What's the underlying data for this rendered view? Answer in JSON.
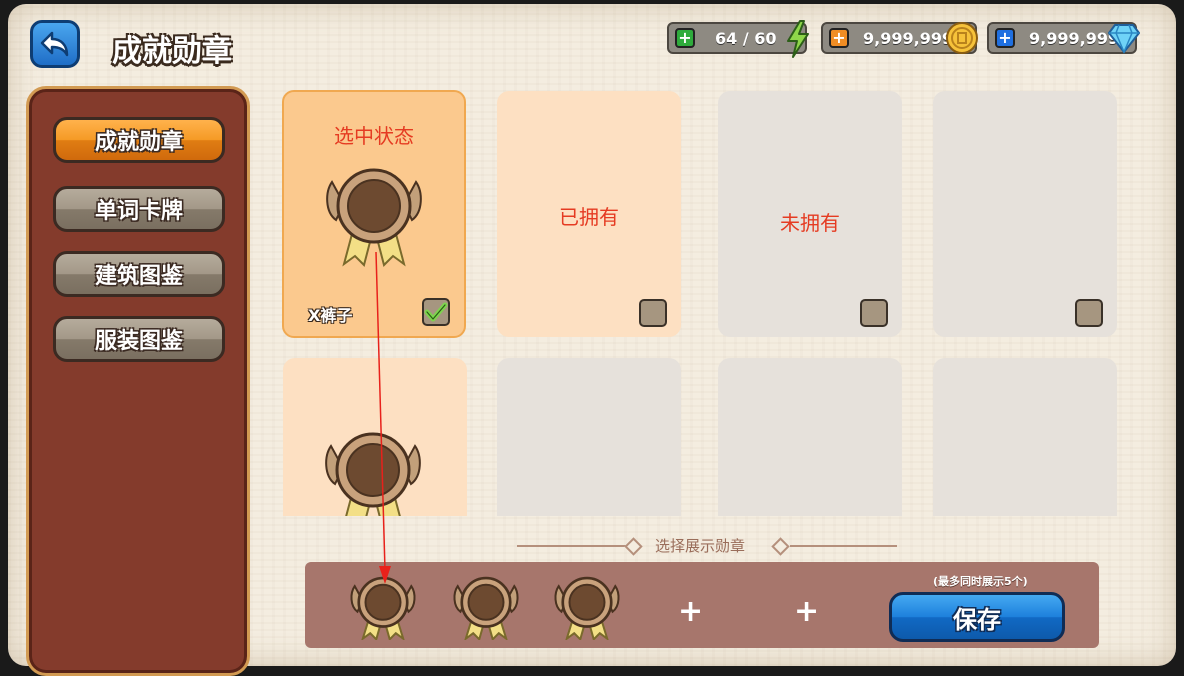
{
  "header": {
    "title": "成就勋章"
  },
  "resources": {
    "energy": "64 / 60",
    "coins": "9,999,999",
    "gems": "9,999,999"
  },
  "sidebar": {
    "items": [
      {
        "label": "成就勋章"
      },
      {
        "label": "单词卡牌"
      },
      {
        "label": "建筑图鉴"
      },
      {
        "label": "服装图鉴"
      }
    ]
  },
  "cards": {
    "selected_label": "选中状态",
    "selected_name": "X裤子",
    "owned_label": "已拥有",
    "not_owned_label": "未拥有"
  },
  "display": {
    "section_title": "选择展示勋章",
    "hint": "(最多同时展示5个)",
    "save_label": "保存",
    "empty_slot": "+"
  }
}
